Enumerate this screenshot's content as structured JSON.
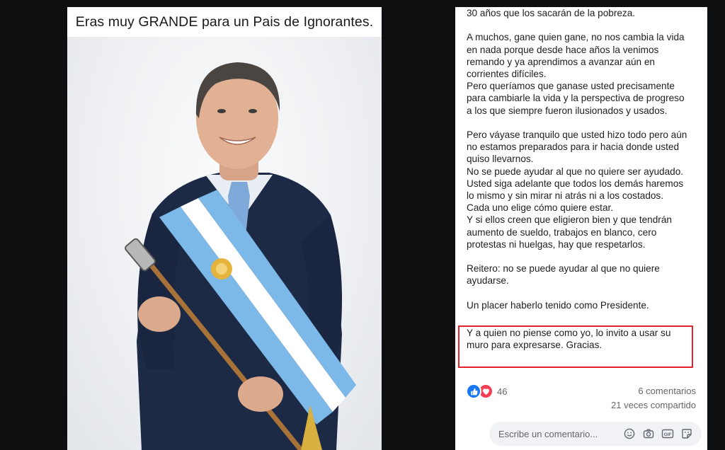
{
  "meme": {
    "caption": "Eras muy GRANDE para un Pais de Ignorantes."
  },
  "post": {
    "paragraphs": [
      [
        "30 años que los sacarán de la pobreza."
      ],
      [
        "A muchos, gane quien gane, no nos cambia la vida",
        "en nada porque desde hace años la venimos",
        "remando y ya aprendimos a avanzar aún en",
        "corrientes difíciles.",
        "Pero queríamos que ganase usted precisamente",
        "para cambiarle la vida y la perspectiva de progreso",
        "a los que siempre fueron ilusionados y usados."
      ],
      [
        "Pero váyase tranquilo que usted hizo todo pero aún",
        "no estamos preparados para ir hacia donde usted",
        "quiso llevarnos.",
        "No se puede ayudar al que no quiere ser ayudado.",
        "Usted siga adelante que todos los demás haremos",
        "lo mismo y sin mirar ni atrás ni a los costados.",
        "Cada uno elige cómo quiere estar.",
        "Y si ellos creen que eligieron bien y que tendrán",
        "aumento de sueldo, trabajos en blanco, cero",
        "protestas ni huelgas, hay que respetarlos."
      ],
      [
        "Reitero: no se puede ayudar al que no quiere",
        "ayudarse."
      ],
      [
        "Un placer haberlo tenido como Presidente."
      ]
    ],
    "highlighted_lines": [
      "Y a quien no piense como yo, lo invito a usar su",
      "muro para expresarse. Gracias."
    ],
    "highlight_color": "#e3232b"
  },
  "footer": {
    "reactions_count": "46",
    "reaction_icons": [
      "like-icon",
      "love-icon"
    ],
    "comments": "6 comentarios",
    "shares": "21 veces compartido",
    "comment_placeholder": "Escribe un comentario...",
    "comment_tools": [
      "emoji-icon",
      "camera-icon",
      "gif-icon",
      "sticker-icon"
    ],
    "like_color": "#1877f2",
    "love_color": "#f33e58"
  }
}
